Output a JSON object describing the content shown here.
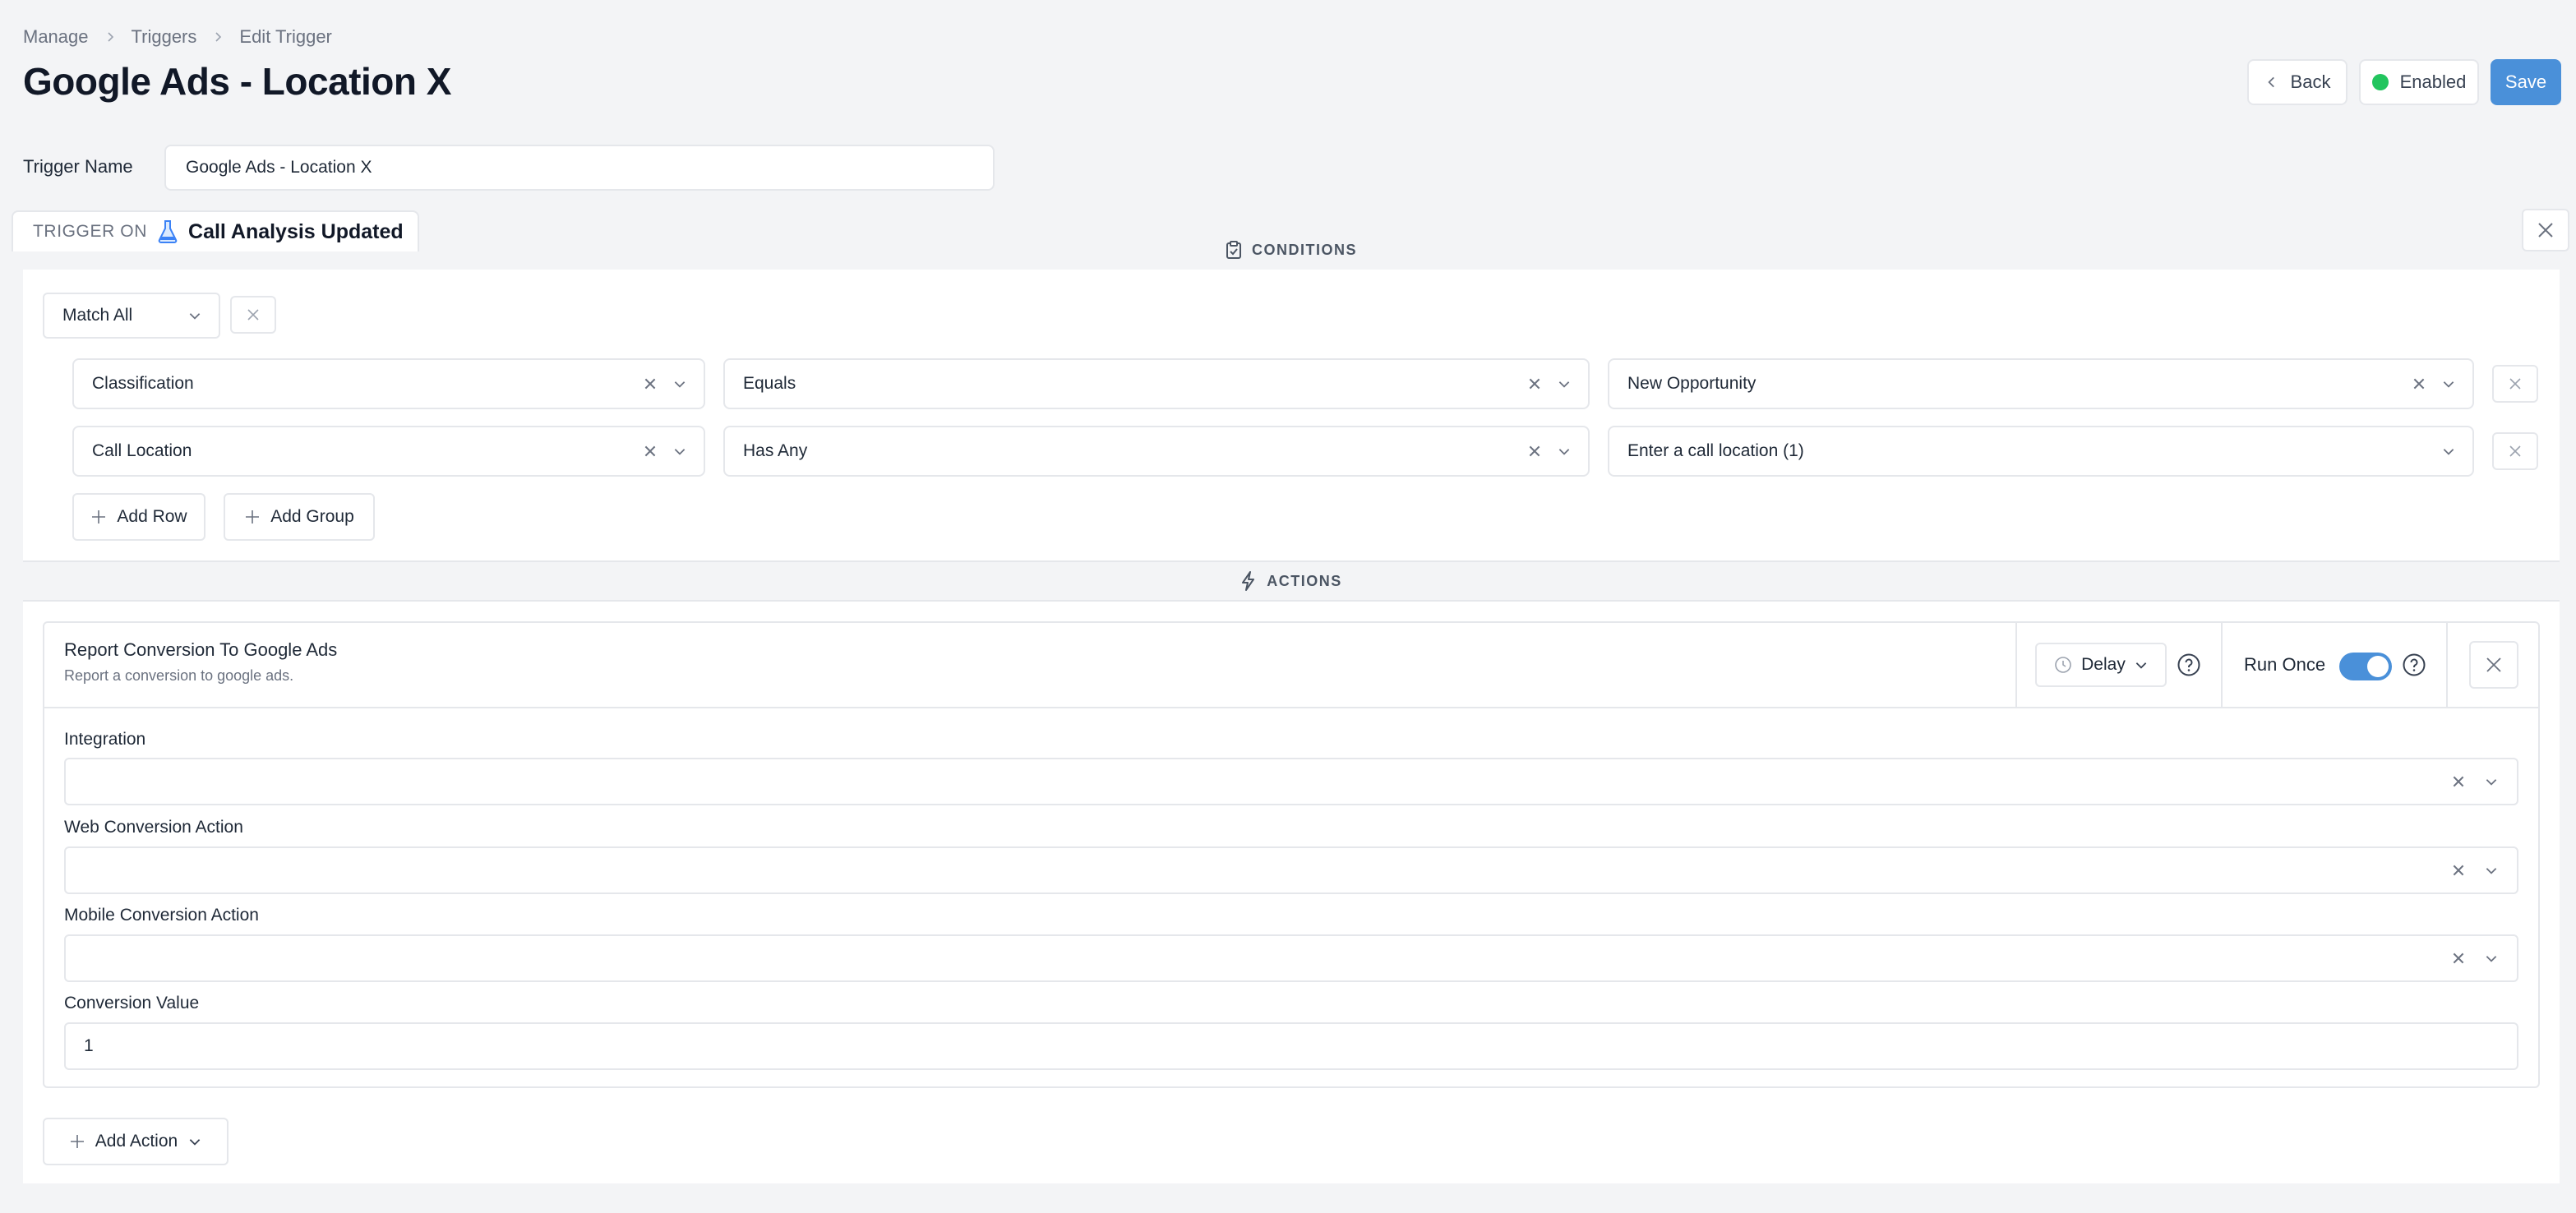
{
  "breadcrumb": {
    "items": [
      "Manage",
      "Triggers",
      "Edit Trigger"
    ]
  },
  "page": {
    "title": "Google Ads - Location X"
  },
  "header": {
    "back_label": "Back",
    "enabled_label": "Enabled",
    "save_label": "Save",
    "accent_color": "#4a90d9",
    "status_color": "#22c55e"
  },
  "trigger": {
    "name_label": "Trigger Name",
    "name_value": "Google Ads - Location X",
    "on_label": "TRIGGER ON",
    "event": "Call Analysis Updated",
    "event_icon": "flask-icon"
  },
  "conditions": {
    "header": "CONDITIONS",
    "header_icon": "clipboard-icon",
    "match": "Match All",
    "rows": [
      {
        "field": "Classification",
        "operator": "Equals",
        "value": "New Opportunity"
      },
      {
        "field": "Call Location",
        "operator": "Has Any",
        "value": "Enter a call location (1)"
      }
    ],
    "add_row_label": "Add Row",
    "add_group_label": "Add Group"
  },
  "actions": {
    "header": "ACTIONS",
    "header_icon": "bolt-icon",
    "items": [
      {
        "title": "Report Conversion To Google Ads",
        "description": "Report a conversion to google ads.",
        "delay_label": "Delay",
        "run_once_label": "Run Once",
        "run_once": true,
        "fields": [
          {
            "label": "Integration",
            "value": ""
          },
          {
            "label": "Web Conversion Action",
            "value": ""
          },
          {
            "label": "Mobile Conversion Action",
            "value": ""
          },
          {
            "label": "Conversion Value",
            "value": "1"
          }
        ]
      }
    ],
    "add_action_label": "Add Action"
  }
}
